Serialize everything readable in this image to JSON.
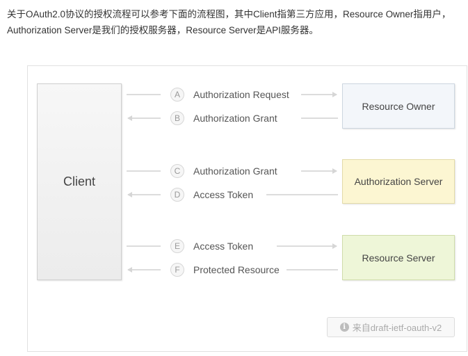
{
  "intro": {
    "line1": "关于OAuth2.0协议的授权流程可以参考下面的流程图，其中Client指第三方应用，Resource Owner指用户，",
    "line2": "Authorization Server是我们的授权服务器，Resource Server是API服务器。"
  },
  "diagram": {
    "client": "Client",
    "resource_owner": "Resource Owner",
    "authorization_server": "Authorization Server",
    "resource_server": "Resource Server",
    "steps": [
      {
        "badge": "A",
        "label": "Authorization Request",
        "direction": "right"
      },
      {
        "badge": "B",
        "label": "Authorization Grant",
        "direction": "left"
      },
      {
        "badge": "C",
        "label": "Authorization Grant",
        "direction": "right"
      },
      {
        "badge": "D",
        "label": "Access Token",
        "direction": "left"
      },
      {
        "badge": "E",
        "label": "Access Token",
        "direction": "right"
      },
      {
        "badge": "F",
        "label": "Protected Resource",
        "direction": "left"
      }
    ],
    "source": "来自draft-ietf-oauth-v2",
    "source_icon": "info-icon"
  },
  "colors": {
    "resource_owner_fill": "#f3f6fa",
    "authorization_server_fill": "#fcf6d2",
    "resource_server_fill": "#eef6d8",
    "arrow": "#d9d9d9"
  }
}
